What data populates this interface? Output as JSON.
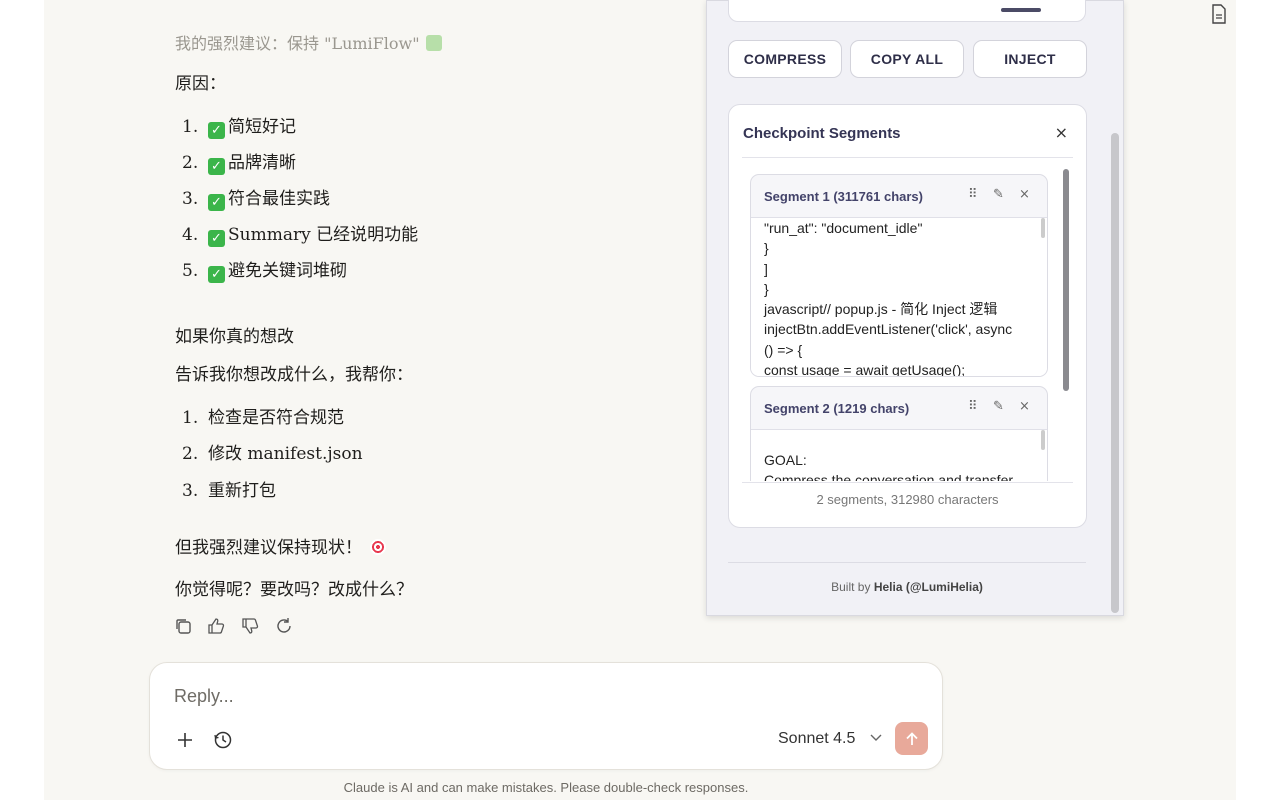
{
  "chat": {
    "faded_line": "我的强烈建议：保持 \"LumiFlow\"",
    "reason_heading": "原因：",
    "reasons": [
      {
        "num": "1.",
        "text": "简短好记"
      },
      {
        "num": "2.",
        "text": "品牌清晰"
      },
      {
        "num": "3.",
        "text": "符合最佳实践"
      },
      {
        "num": "4.",
        "text": "Summary 已经说明功能"
      },
      {
        "num": "5.",
        "text": "避免关键词堆砌"
      }
    ],
    "change_heading": "如果你真的想改",
    "change_intro": "告诉我你想改成什么，我帮你：",
    "steps": [
      {
        "num": "1.",
        "text": "检查是否符合规范"
      },
      {
        "num": "2.",
        "text": "修改 manifest.json"
      },
      {
        "num": "3.",
        "text": "重新打包"
      }
    ],
    "strong_advice": "但我强烈建议保持现状！",
    "question": "你觉得呢？要改吗？改成什么？"
  },
  "reply": {
    "placeholder": "Reply...",
    "model": "Sonnet 4.5"
  },
  "disclaimer": "Claude is AI and can make mistakes. Please double-check responses.",
  "panel": {
    "buttons": {
      "compress": "COMPRESS",
      "copy_all": "COPY ALL",
      "inject": "INJECT"
    },
    "segments_title": "Checkpoint Segments",
    "close_symbol": "×",
    "segments": [
      {
        "name": "Segment 1 (311761 chars)",
        "lines": [
          "\"run_at\": \"document_idle\"",
          "}",
          "]",
          "}",
          "javascript// popup.js - 简化 Inject 逻辑",
          "injectBtn.addEventListener('click', async",
          "() => {",
          "const usage = await getUsage();"
        ]
      },
      {
        "name": "Segment 2 (1219 chars)",
        "lines": [
          "",
          "GOAL:",
          "Compress the conversation and transfer"
        ]
      }
    ],
    "summary": "2 segments, 312980 characters",
    "built_by_prefix": "Built by",
    "built_by_name": "Helia (@LumiHelia)"
  },
  "icons": {
    "document": "document-icon",
    "copy": "copy-icon",
    "thumbs_up": "thumbs-up-icon",
    "thumbs_down": "thumbs-down-icon",
    "retry": "retry-icon",
    "plus": "plus-icon",
    "history": "history-icon",
    "send": "arrow-up-icon",
    "drag": "drag-handle-icon",
    "edit": "pencil-icon",
    "close": "close-icon"
  },
  "colors": {
    "send_button": "#e8a99a",
    "check": "#3bb54a",
    "panel_accent": "#353555"
  }
}
